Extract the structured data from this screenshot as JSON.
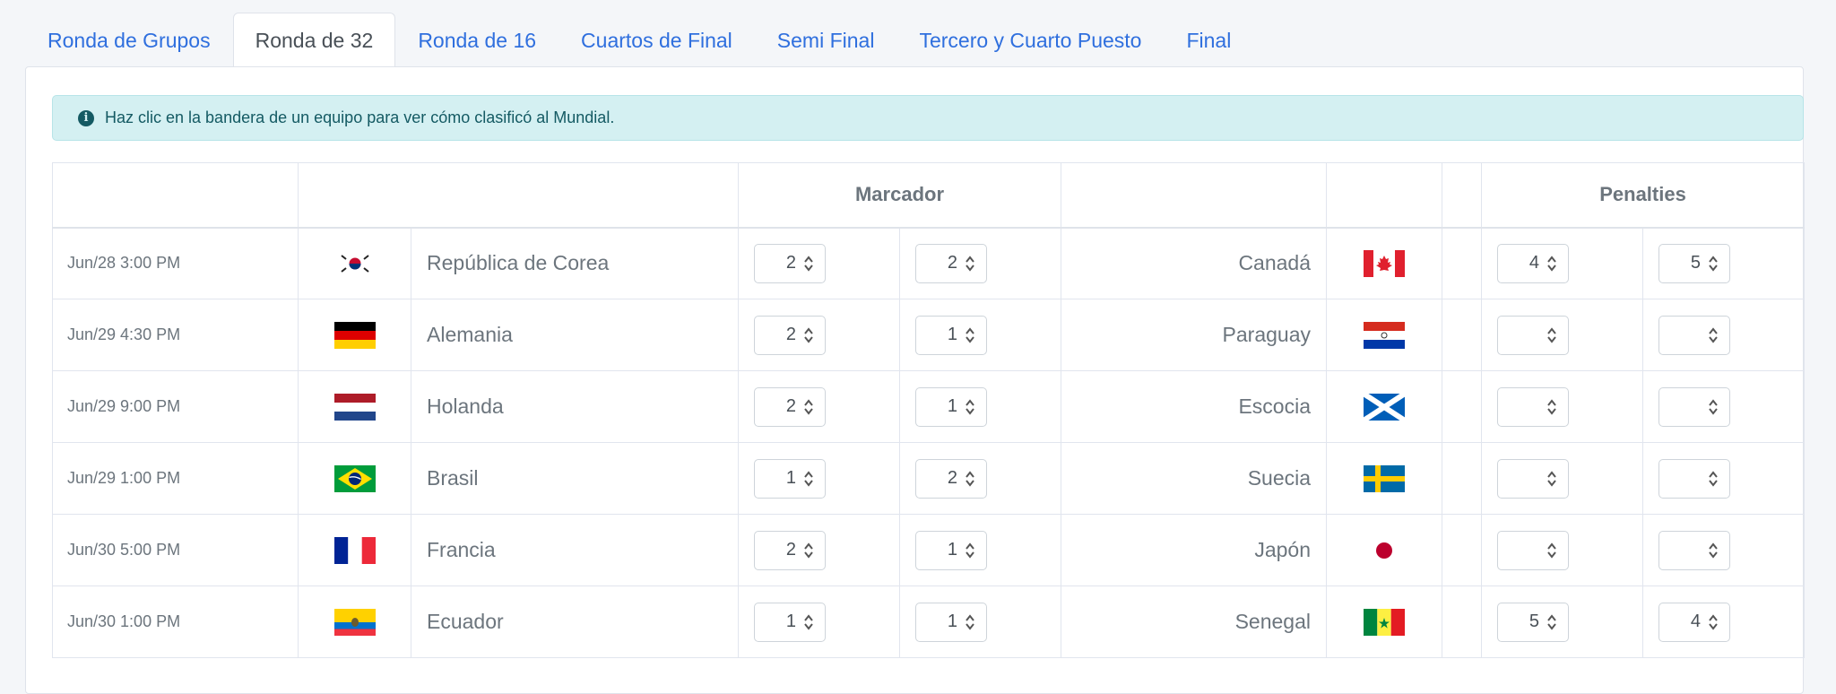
{
  "tabs": [
    {
      "label": "Ronda de Grupos",
      "active": false
    },
    {
      "label": "Ronda de 32",
      "active": true
    },
    {
      "label": "Ronda de 16",
      "active": false
    },
    {
      "label": "Cuartos de Final",
      "active": false
    },
    {
      "label": "Semi Final",
      "active": false
    },
    {
      "label": "Tercero y Cuarto Puesto",
      "active": false
    },
    {
      "label": "Final",
      "active": false
    }
  ],
  "alert": {
    "icon": "info-circle-icon",
    "text": "Haz clic en la bandera de un equipo para ver cómo clasificó al Mundial."
  },
  "table": {
    "headers": {
      "marcador": "Marcador",
      "penalties": "Penalties"
    },
    "matches": [
      {
        "date": "Jun/28 3:00 PM",
        "home": "República de Corea",
        "home_flag": "south-korea-flag-icon",
        "home_score": "2",
        "away_score": "2",
        "away": "Canadá",
        "away_flag": "canada-flag-icon",
        "pen_home": "4",
        "pen_away": "5"
      },
      {
        "date": "Jun/29 4:30 PM",
        "home": "Alemania",
        "home_flag": "germany-flag-icon",
        "home_score": "2",
        "away_score": "1",
        "away": "Paraguay",
        "away_flag": "paraguay-flag-icon",
        "pen_home": "",
        "pen_away": ""
      },
      {
        "date": "Jun/29 9:00 PM",
        "home": "Holanda",
        "home_flag": "netherlands-flag-icon",
        "home_score": "2",
        "away_score": "1",
        "away": "Escocia",
        "away_flag": "scotland-flag-icon",
        "pen_home": "",
        "pen_away": ""
      },
      {
        "date": "Jun/29 1:00 PM",
        "home": "Brasil",
        "home_flag": "brazil-flag-icon",
        "home_score": "1",
        "away_score": "2",
        "away": "Suecia",
        "away_flag": "sweden-flag-icon",
        "pen_home": "",
        "pen_away": ""
      },
      {
        "date": "Jun/30 5:00 PM",
        "home": "Francia",
        "home_flag": "france-flag-icon",
        "home_score": "2",
        "away_score": "1",
        "away": "Japón",
        "away_flag": "japan-flag-icon",
        "pen_home": "",
        "pen_away": ""
      },
      {
        "date": "Jun/30 1:00 PM",
        "home": "Ecuador",
        "home_flag": "ecuador-flag-icon",
        "home_score": "1",
        "away_score": "1",
        "away": "Senegal",
        "away_flag": "senegal-flag-icon",
        "pen_home": "5",
        "pen_away": "4"
      }
    ]
  },
  "colors": {
    "tab_link": "#2f6fde",
    "alert_bg": "#d4f0f2",
    "alert_text": "#145a63",
    "border": "#e1e5ee"
  }
}
